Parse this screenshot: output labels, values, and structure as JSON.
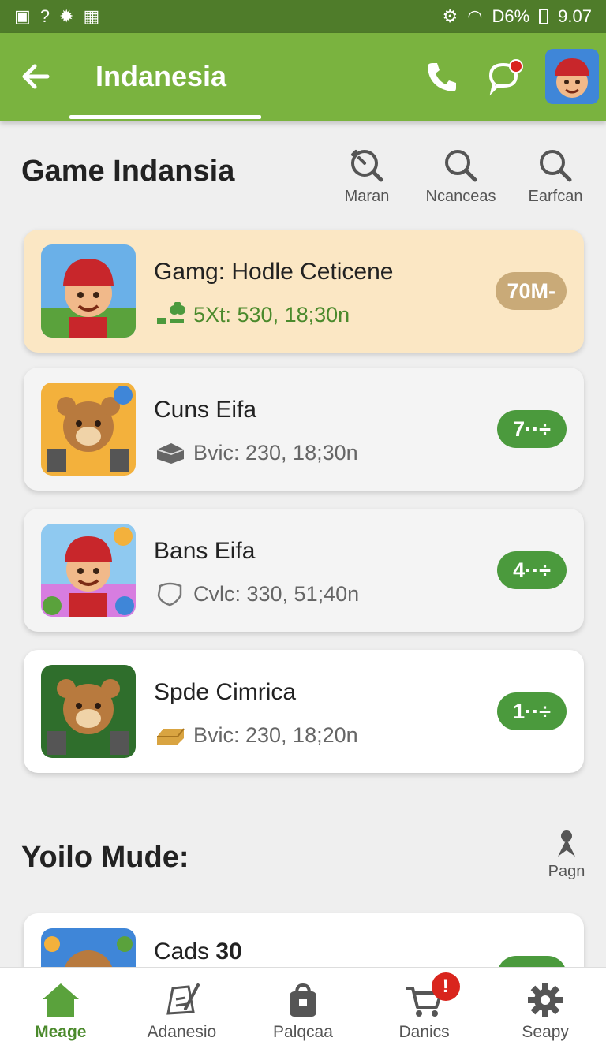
{
  "status_bar": {
    "left_icons": [
      "image-icon",
      "question-icon",
      "bug-icon",
      "grid-app-icon"
    ],
    "left_glyphs": [
      "▣",
      "?",
      "✹",
      "▦"
    ],
    "right_glyphs": [
      "⚙",
      "◠"
    ],
    "signal_text": "D6%",
    "time": "9.07"
  },
  "app_bar": {
    "title": "Indanesia",
    "accent_color": "#7ab33f"
  },
  "section": {
    "title": "Game Indansia",
    "actions": [
      {
        "label": "Maran",
        "icon": "clock-search-icon"
      },
      {
        "label": "Ncanceas",
        "icon": "search-icon"
      },
      {
        "label": "Earfcan",
        "icon": "search-icon"
      }
    ]
  },
  "games": [
    {
      "title": "Gamg: Hodle Ceticene",
      "meta": "5Xt:  530,  18;30n",
      "badge": "70M-",
      "icon": "clover-icon"
    },
    {
      "title": "Cuns Eifa",
      "meta": "Bvic:  230,  18;30n",
      "badge": "7··÷",
      "icon": "box-icon"
    },
    {
      "title": "Bans Eifa",
      "meta": "Cvlc:  330,  51;40n",
      "badge": "4··÷",
      "icon": "shield-icon"
    },
    {
      "title": "Spde Cimrica",
      "meta": "Bvic:  230,  18;20n",
      "badge": "1··÷",
      "icon": "gold-bar-icon"
    }
  ],
  "section2": {
    "title": "Yoilo Mude:",
    "action_label": "Pagn",
    "partial_title_prefix": "Cads ",
    "partial_title_bold": "30"
  },
  "bottom_nav": [
    {
      "label": "Meage",
      "icon": "home-icon",
      "active": true
    },
    {
      "label": "Adanesio",
      "icon": "edit-icon",
      "active": false
    },
    {
      "label": "Palqcaa",
      "icon": "bag-icon",
      "active": false
    },
    {
      "label": "Danics",
      "icon": "cart-icon",
      "active": false,
      "badge": "!"
    },
    {
      "label": "Seapy",
      "icon": "gear-icon",
      "active": false
    }
  ]
}
